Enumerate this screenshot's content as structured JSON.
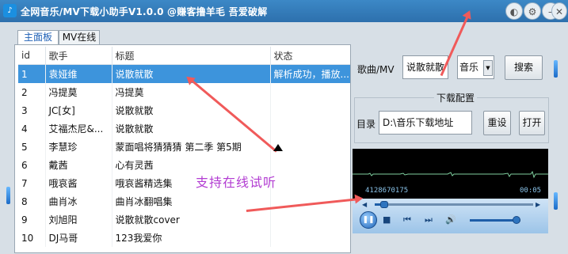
{
  "window": {
    "title": "全网音乐/MV下载小助手V1.0.0   @赚客撸羊毛   吾爱破解",
    "app_icon": "music-icon",
    "buttons": [
      "skin-icon",
      "settings-icon",
      "minimize-icon",
      "close-icon"
    ]
  },
  "tabs": [
    {
      "label": "主面板",
      "active": true
    },
    {
      "label": "MV在线",
      "active": false
    }
  ],
  "table": {
    "columns": [
      "id",
      "歌手",
      "标题",
      "状态"
    ],
    "rows": [
      {
        "id": "1",
        "artist": "袁娅维",
        "title": "说散就散",
        "status": "解析成功，播放...",
        "selected": true
      },
      {
        "id": "2",
        "artist": "冯提莫",
        "title": "冯提莫",
        "status": ""
      },
      {
        "id": "3",
        "artist": "JC[女]",
        "title": "说散就散",
        "status": ""
      },
      {
        "id": "4",
        "artist": "艾福杰尼&...",
        "title": "说散就散",
        "status": ""
      },
      {
        "id": "5",
        "artist": "李慧珍",
        "title": "蒙面唱将猜猜猜 第二季 第5期",
        "status": ""
      },
      {
        "id": "6",
        "artist": "戴茜",
        "title": "心有灵茜",
        "status": ""
      },
      {
        "id": "7",
        "artist": "哦哀酱",
        "title": "哦哀酱精选集",
        "status": ""
      },
      {
        "id": "8",
        "artist": "曲肖冰",
        "title": "曲肖冰翻唱集",
        "status": ""
      },
      {
        "id": "9",
        "artist": "刘旭阳",
        "title": "说散就散cover",
        "status": ""
      },
      {
        "id": "10",
        "artist": "DJ马哥",
        "title": "123我爱你",
        "status": ""
      }
    ]
  },
  "search": {
    "label": "歌曲/MV",
    "value": "说散就散",
    "type_selected": "音乐",
    "search_button": "搜索"
  },
  "download_config": {
    "title": "下载配置",
    "dir_label": "目录",
    "dir_value": "D:\\音乐下载地址",
    "reset_button": "重设",
    "open_button": "打开"
  },
  "player": {
    "track_code": "4128670175",
    "time": "00:05",
    "seek_progress": 0.06,
    "volume_level": 0.92
  },
  "annotation": "支持在线试听",
  "colors": {
    "titlebar": "#2d70ad",
    "selection": "#3d94dc",
    "annotation_text": "#b23cd2",
    "arrow": "#f05a5a"
  }
}
